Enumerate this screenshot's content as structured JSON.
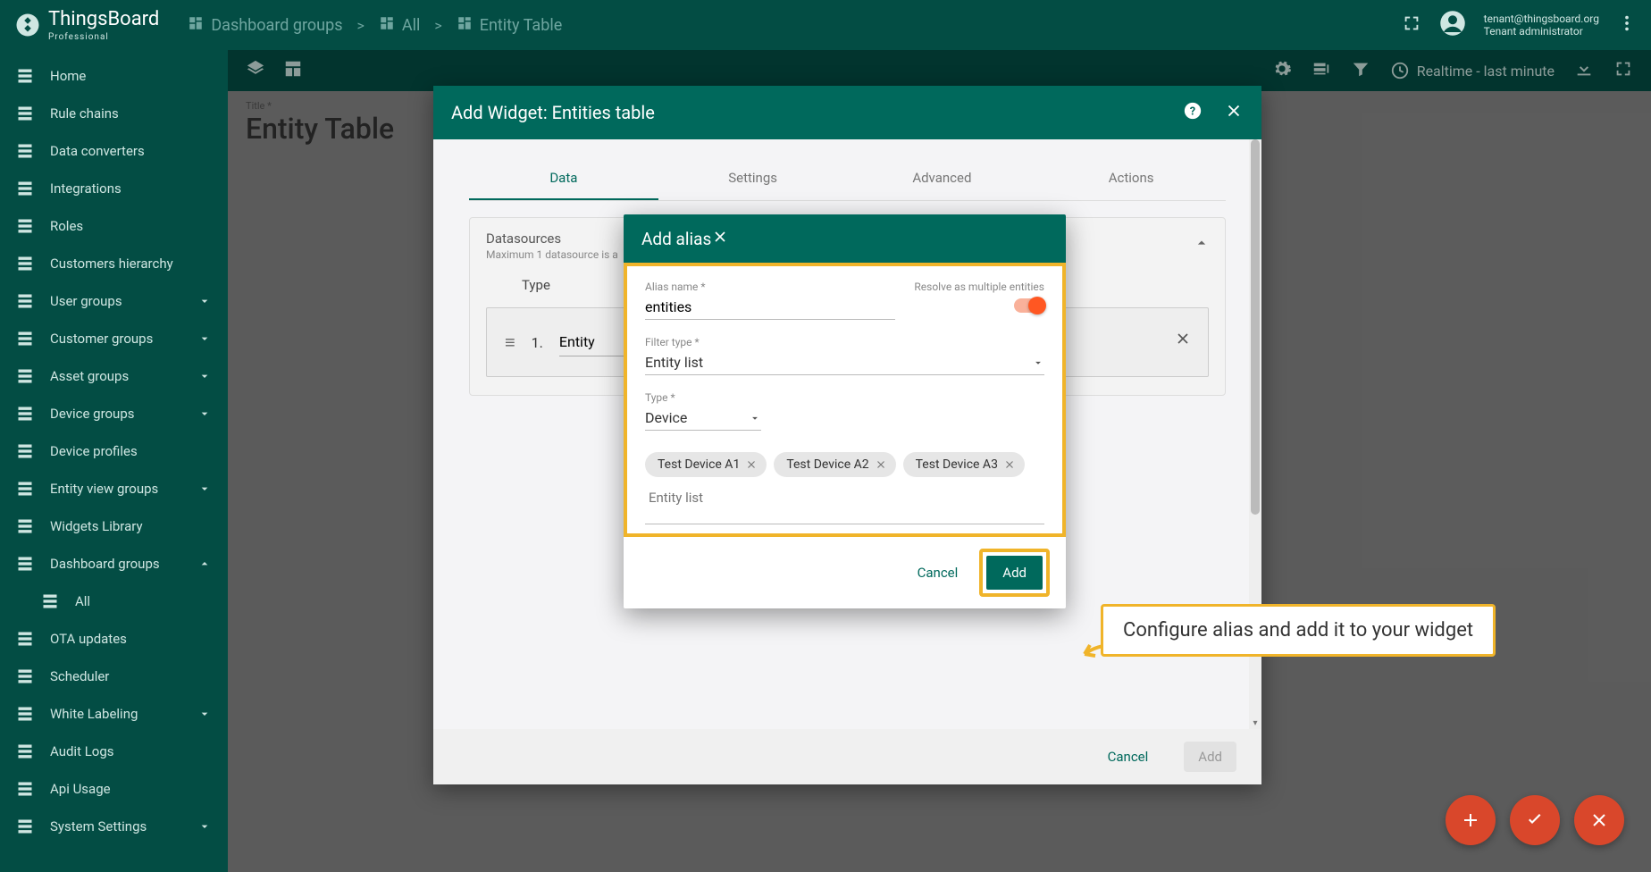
{
  "brand": {
    "name": "ThingsBoard",
    "sub": "Professional"
  },
  "breadcrumb": [
    "Dashboard groups",
    "All",
    "Entity Table"
  ],
  "user": {
    "email": "tenant@thingsboard.org",
    "role": "Tenant administrator"
  },
  "sidebar": {
    "items": [
      {
        "label": "Home",
        "icon": "home"
      },
      {
        "label": "Rule chains",
        "icon": "rules"
      },
      {
        "label": "Data converters",
        "icon": "convert"
      },
      {
        "label": "Integrations",
        "icon": "integr"
      },
      {
        "label": "Roles",
        "icon": "shield"
      },
      {
        "label": "Customers hierarchy",
        "icon": "hier"
      },
      {
        "label": "User groups",
        "icon": "user",
        "expand": true
      },
      {
        "label": "Customer groups",
        "icon": "cust",
        "expand": true
      },
      {
        "label": "Asset groups",
        "icon": "asset",
        "expand": true
      },
      {
        "label": "Device groups",
        "icon": "dev",
        "expand": true
      },
      {
        "label": "Device profiles",
        "icon": "devp"
      },
      {
        "label": "Entity view groups",
        "icon": "entv",
        "expand": true
      },
      {
        "label": "Widgets Library",
        "icon": "widg"
      },
      {
        "label": "Dashboard groups",
        "icon": "dash",
        "expand": true,
        "open": true
      },
      {
        "label": "All",
        "icon": "all",
        "child": true
      },
      {
        "label": "OTA updates",
        "icon": "ota"
      },
      {
        "label": "Scheduler",
        "icon": "sched"
      },
      {
        "label": "White Labeling",
        "icon": "white",
        "expand": true
      },
      {
        "label": "Audit Logs",
        "icon": "audit"
      },
      {
        "label": "Api Usage",
        "icon": "api"
      },
      {
        "label": "System Settings",
        "icon": "sys",
        "expand": true
      }
    ]
  },
  "dash_toolbar": {
    "realtime": "Realtime - last minute"
  },
  "page": {
    "title_label": "Title *",
    "title": "Entity Table"
  },
  "add_widget": {
    "title": "Add Widget: Entities table",
    "tabs": [
      "Data",
      "Settings",
      "Advanced",
      "Actions"
    ],
    "ds_head": "Datasources",
    "ds_sub": "Maximum 1 datasource is a",
    "type_label": "Type",
    "row_num": "1.",
    "row_type": "Entity",
    "cancel": "Cancel",
    "add": "Add"
  },
  "add_alias": {
    "title": "Add alias",
    "alias_label": "Alias name *",
    "alias_value": "entities",
    "resolve_label": "Resolve as multiple entities",
    "filter_label": "Filter type *",
    "filter_value": "Entity list",
    "type_label": "Type *",
    "type_value": "Device",
    "chips": [
      "Test Device A1",
      "Test Device A2",
      "Test Device A3"
    ],
    "chip_placeholder": "Entity list",
    "cancel": "Cancel",
    "add": "Add"
  },
  "callout": "Configure alias and add it to your widget"
}
